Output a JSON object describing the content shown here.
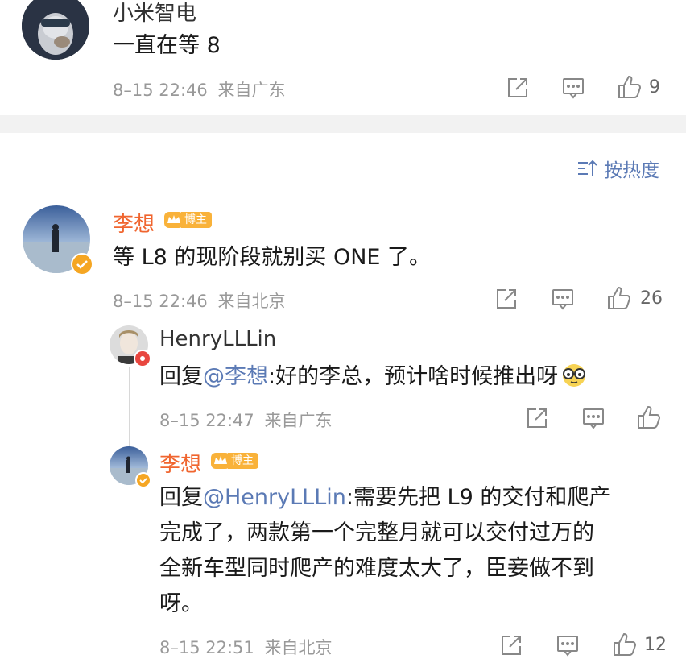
{
  "top_comment": {
    "author": "小米智电",
    "text": "一直在等 8",
    "time": "8–15 22:46",
    "location": "来自广东",
    "like_count": "9"
  },
  "sort": {
    "label": "按热度",
    "icon": "sort-icon"
  },
  "main_comment": {
    "author": "李想",
    "badge": "博主",
    "text": "等 L8 的现阶段就别买 ONE 了。",
    "time": "8–15 22:46",
    "location": "来自北京",
    "like_count": "26"
  },
  "reply1": {
    "author": "HenryLLLin",
    "prefix": "回复",
    "mention": "@李想",
    "text": ":好的李总，预计啥时候推出呀",
    "emoji": "glasses-emoji",
    "time": "8–15 22:47",
    "location": "来自广东"
  },
  "reply2": {
    "author": "李想",
    "badge": "博主",
    "prefix": "回复",
    "mention": "@HenryLLLin",
    "line1": ":需要先把 L9 的交付和爬产",
    "line2": "完成了，两款第一个完整月就可以交付过万的",
    "line3": "全新车型同时爬产的难度太大了，臣妾做不到",
    "line4": "呀。",
    "time": "8–15 22:51",
    "location": "来自北京",
    "like_count": "12"
  },
  "colors": {
    "accent_name": "#f0652f",
    "mention": "#5b7ab5",
    "badge": "#f9b23a",
    "verified": "#f5a623"
  }
}
